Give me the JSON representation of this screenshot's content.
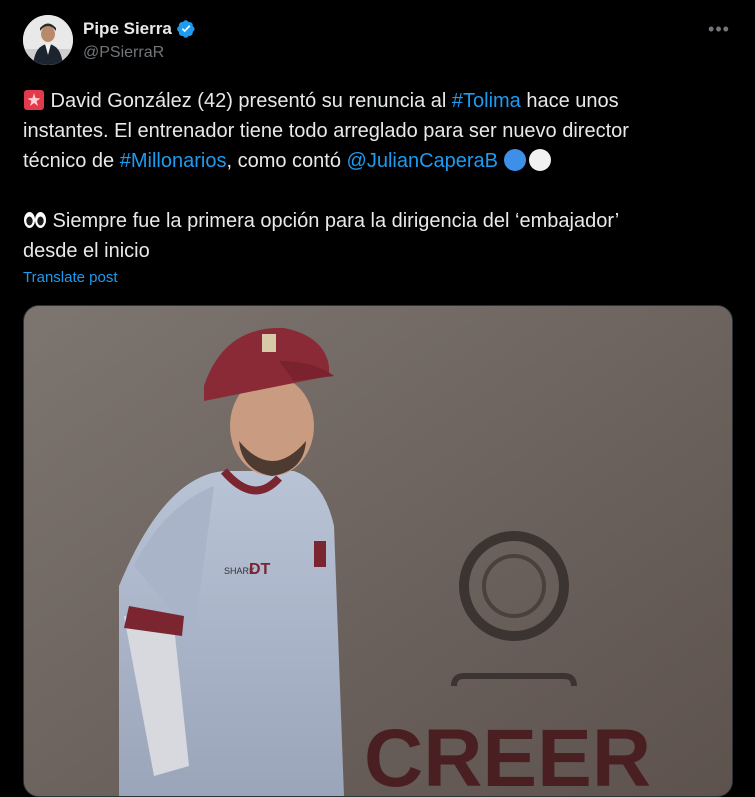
{
  "author": {
    "name": "Pipe Sierra",
    "handle": "@PSierraR"
  },
  "tweet": {
    "line1": {
      "prefix": " David González (42) presentó su renuncia al ",
      "hashtag": "#Tolima",
      "suffix": " hace unos"
    },
    "line2": "instantes. El entrenador tiene todo arreglado para ser nuevo director",
    "line3": {
      "prefix": "técnico de ",
      "hashtag": "#Millonarios",
      "middle": ", como contó ",
      "mention": "@JulianCaperaB"
    },
    "line4": " Siempre fue la primera opción para la dirigencia del ‘embajador’",
    "line5": "desde el inicio"
  },
  "translate_label": "Translate post",
  "media": {
    "type": "photo",
    "jersey_text": "DT",
    "sponsor_text": "SHARK",
    "wall_text": "CREER"
  },
  "icons": {
    "verified": "verified-badge-icon",
    "more": "more-options-icon",
    "siren": "siren-emoji",
    "eyes": "eyes-emoji"
  },
  "colors": {
    "background": "#000000",
    "text": "#e7e9ea",
    "secondary": "#71767b",
    "link": "#1d9bf0",
    "verified": "#1d9bf0"
  }
}
